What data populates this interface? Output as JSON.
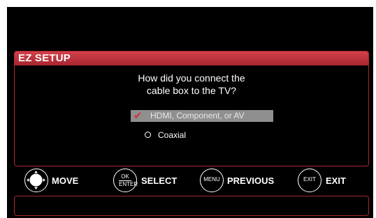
{
  "panel": {
    "title": "EZ SETUP",
    "question_line1": "How did you connect the",
    "question_line2": "cable box to the TV?"
  },
  "options": [
    {
      "label": "HDMI, Component, or AV",
      "selected": true
    },
    {
      "label": "Coaxial",
      "selected": false
    }
  ],
  "controls": {
    "move": {
      "label": "MOVE",
      "icon": "dpad-icon"
    },
    "select": {
      "label": "SELECT",
      "icon_top": "OK",
      "icon_bottom": "ENTER"
    },
    "previous": {
      "label": "PREVIOUS",
      "icon": "MENU"
    },
    "exit": {
      "label": "EXIT",
      "icon": "EXIT"
    }
  },
  "colors": {
    "accent": "#c4323c",
    "border": "#a62a2f",
    "selected_bg": "#8f8f8f",
    "background": "#000000"
  }
}
